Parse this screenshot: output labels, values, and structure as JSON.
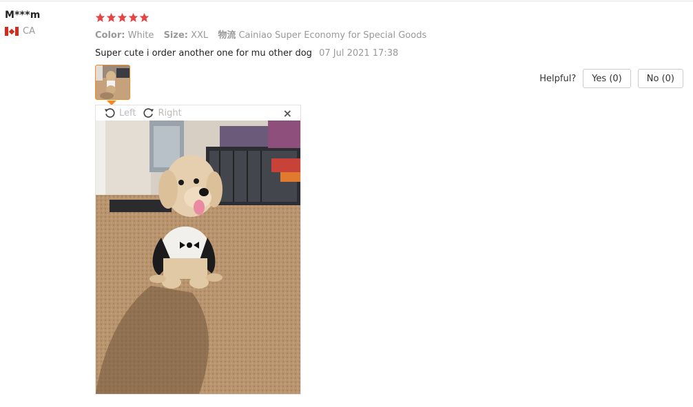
{
  "reviewer": {
    "name": "M***m",
    "country": "CA"
  },
  "rating": {
    "stars": 5,
    "color": "#e64545"
  },
  "attributes": {
    "color_label": "Color:",
    "color_value": "White",
    "size_label": "Size:",
    "size_value": "XXL",
    "shipping_label": "物流",
    "shipping_value": "Cainiao Super Economy for Special Goods"
  },
  "review": {
    "text": "Super cute i order another one for mu other dog",
    "date": "07 Jul 2021 17:38"
  },
  "helpful": {
    "label": "Helpful?",
    "yes": "Yes (0)",
    "no": "No (0)"
  },
  "viewer": {
    "rotate_left": "Left",
    "rotate_right": "Right",
    "close": "×"
  },
  "colors": {
    "accent": "#f08a24"
  },
  "icons": [
    "canada-flag-icon",
    "star-icon",
    "rotate-left-icon",
    "rotate-right-icon",
    "close-icon"
  ]
}
